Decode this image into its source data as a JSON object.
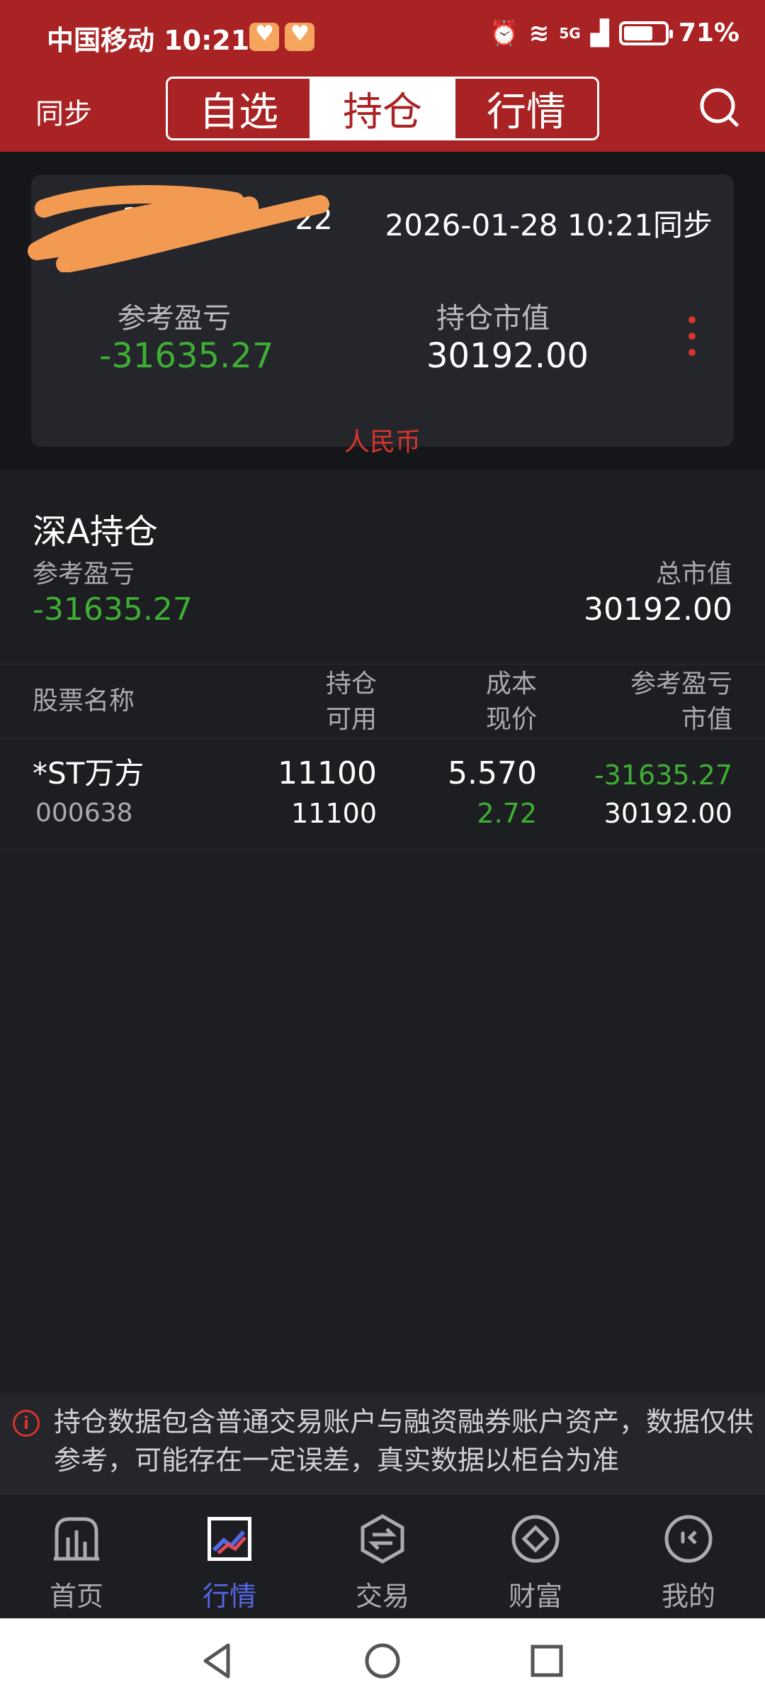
{
  "status_bar": {
    "carrier_time": "中国移动 10:21",
    "network": "5G",
    "battery": "71%"
  },
  "header": {
    "sync_label": "同步",
    "tabs": [
      "自选",
      "持仓",
      "行情"
    ],
    "active_tab": "持仓"
  },
  "account": {
    "id": "332650****22",
    "sync_time": "2026-01-28 10:21同步",
    "pl_label": "参考盈亏",
    "pl_value": "-31635.27",
    "market_value_label": "持仓市值",
    "market_value": "30192.00",
    "currency": "人民币"
  },
  "summary": {
    "title": "深A持仓",
    "pl_label": "参考盈亏",
    "pl_value": "-31635.27",
    "total_mv_label": "总市值",
    "total_mv_value": "30192.00"
  },
  "table": {
    "headers": {
      "name": "股票名称",
      "position": "持仓",
      "available": "可用",
      "cost": "成本",
      "price": "现价",
      "pl": "参考盈亏",
      "mv": "市值"
    },
    "rows": [
      {
        "name": "*ST万方",
        "code": "000638",
        "position": "11100",
        "available": "11100",
        "cost": "5.570",
        "price": "2.72",
        "pl": "-31635.27",
        "mv": "30192.00"
      }
    ]
  },
  "notice": {
    "text": "持仓数据包含普通交易账户与融资融券账户资产，数据仅供参考，可能存在一定误差，真实数据以柜台为准"
  },
  "bottom_nav": {
    "items": [
      "首页",
      "行情",
      "交易",
      "财富",
      "我的"
    ],
    "active": "行情"
  },
  "colors": {
    "brand_red": "#aa2324",
    "loss_green": "#3fae35",
    "accent_blue": "#5467e6",
    "background": "#1d1e21"
  }
}
